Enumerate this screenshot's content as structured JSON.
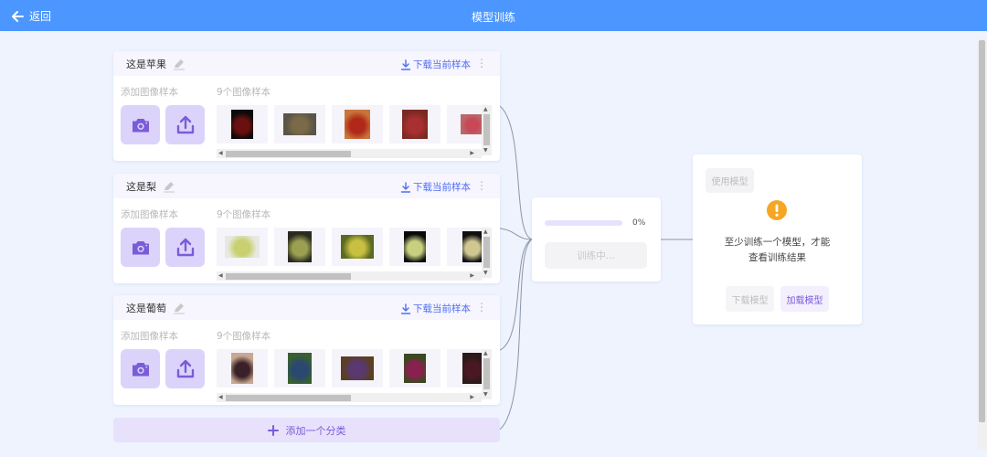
{
  "topbar": {
    "back_label": "返回",
    "title": "模型训练"
  },
  "classes": [
    {
      "name": "这是苹果",
      "download_label": "下载当前样本",
      "add_label": "添加图像样本",
      "count_label": "9个图像样本",
      "thumbs": [
        {
          "fg": "#6b1010",
          "bg": "#0a0a0a",
          "w": 24,
          "h": 32
        },
        {
          "fg": "#7a6a48",
          "bg": "#5a5548",
          "w": 36,
          "h": 24
        },
        {
          "fg": "#b02818",
          "bg": "#c8743a",
          "w": 28,
          "h": 32
        },
        {
          "fg": "#a83030",
          "bg": "#7a2a22",
          "w": 28,
          "h": 32
        },
        {
          "fg": "#c84858",
          "bg": "#b86a6a",
          "w": 26,
          "h": 22
        }
      ]
    },
    {
      "name": "这是梨",
      "download_label": "下载当前样本",
      "add_label": "添加图像样本",
      "count_label": "9个图像样本",
      "thumbs": [
        {
          "fg": "#c8d070",
          "bg": "#e8e8e0",
          "w": 38,
          "h": 24
        },
        {
          "fg": "#9aa050",
          "bg": "#2a2a20",
          "w": 26,
          "h": 34
        },
        {
          "fg": "#c8c040",
          "bg": "#5a6a20",
          "w": 36,
          "h": 26
        },
        {
          "fg": "#c8d080",
          "bg": "#0a0a0a",
          "w": 24,
          "h": 34
        },
        {
          "fg": "#d0c890",
          "bg": "#101010",
          "w": 22,
          "h": 34
        }
      ]
    },
    {
      "name": "这是葡萄",
      "download_label": "下载当前样本",
      "add_label": "添加图像样本",
      "count_label": "9个图像样本",
      "thumbs": [
        {
          "fg": "#3a2028",
          "bg": "#c8a890",
          "w": 24,
          "h": 34
        },
        {
          "fg": "#2a4870",
          "bg": "#3a6030",
          "w": 26,
          "h": 34
        },
        {
          "fg": "#5a3870",
          "bg": "#5a4020",
          "w": 36,
          "h": 26
        },
        {
          "fg": "#8a2050",
          "bg": "#3a4a20",
          "w": 24,
          "h": 32
        },
        {
          "fg": "#4a1820",
          "bg": "#2a1a1a",
          "w": 22,
          "h": 34
        }
      ]
    }
  ],
  "add_class_label": "添加一个分类",
  "training": {
    "progress": 0,
    "percent_label": "0%",
    "button_label": "训练中..."
  },
  "result": {
    "use_model_label": "使用模型",
    "message_line1": "至少训练一个模型，才能",
    "message_line2": "查看训练结果",
    "download_model_label": "下载模型",
    "load_model_label": "加载模型"
  },
  "colors": {
    "topbar": "#4c97ff",
    "accent": "#7a5cd9",
    "link": "#4c6ef5",
    "warning": "#f5a623",
    "page_bg": "#eef3fe"
  }
}
